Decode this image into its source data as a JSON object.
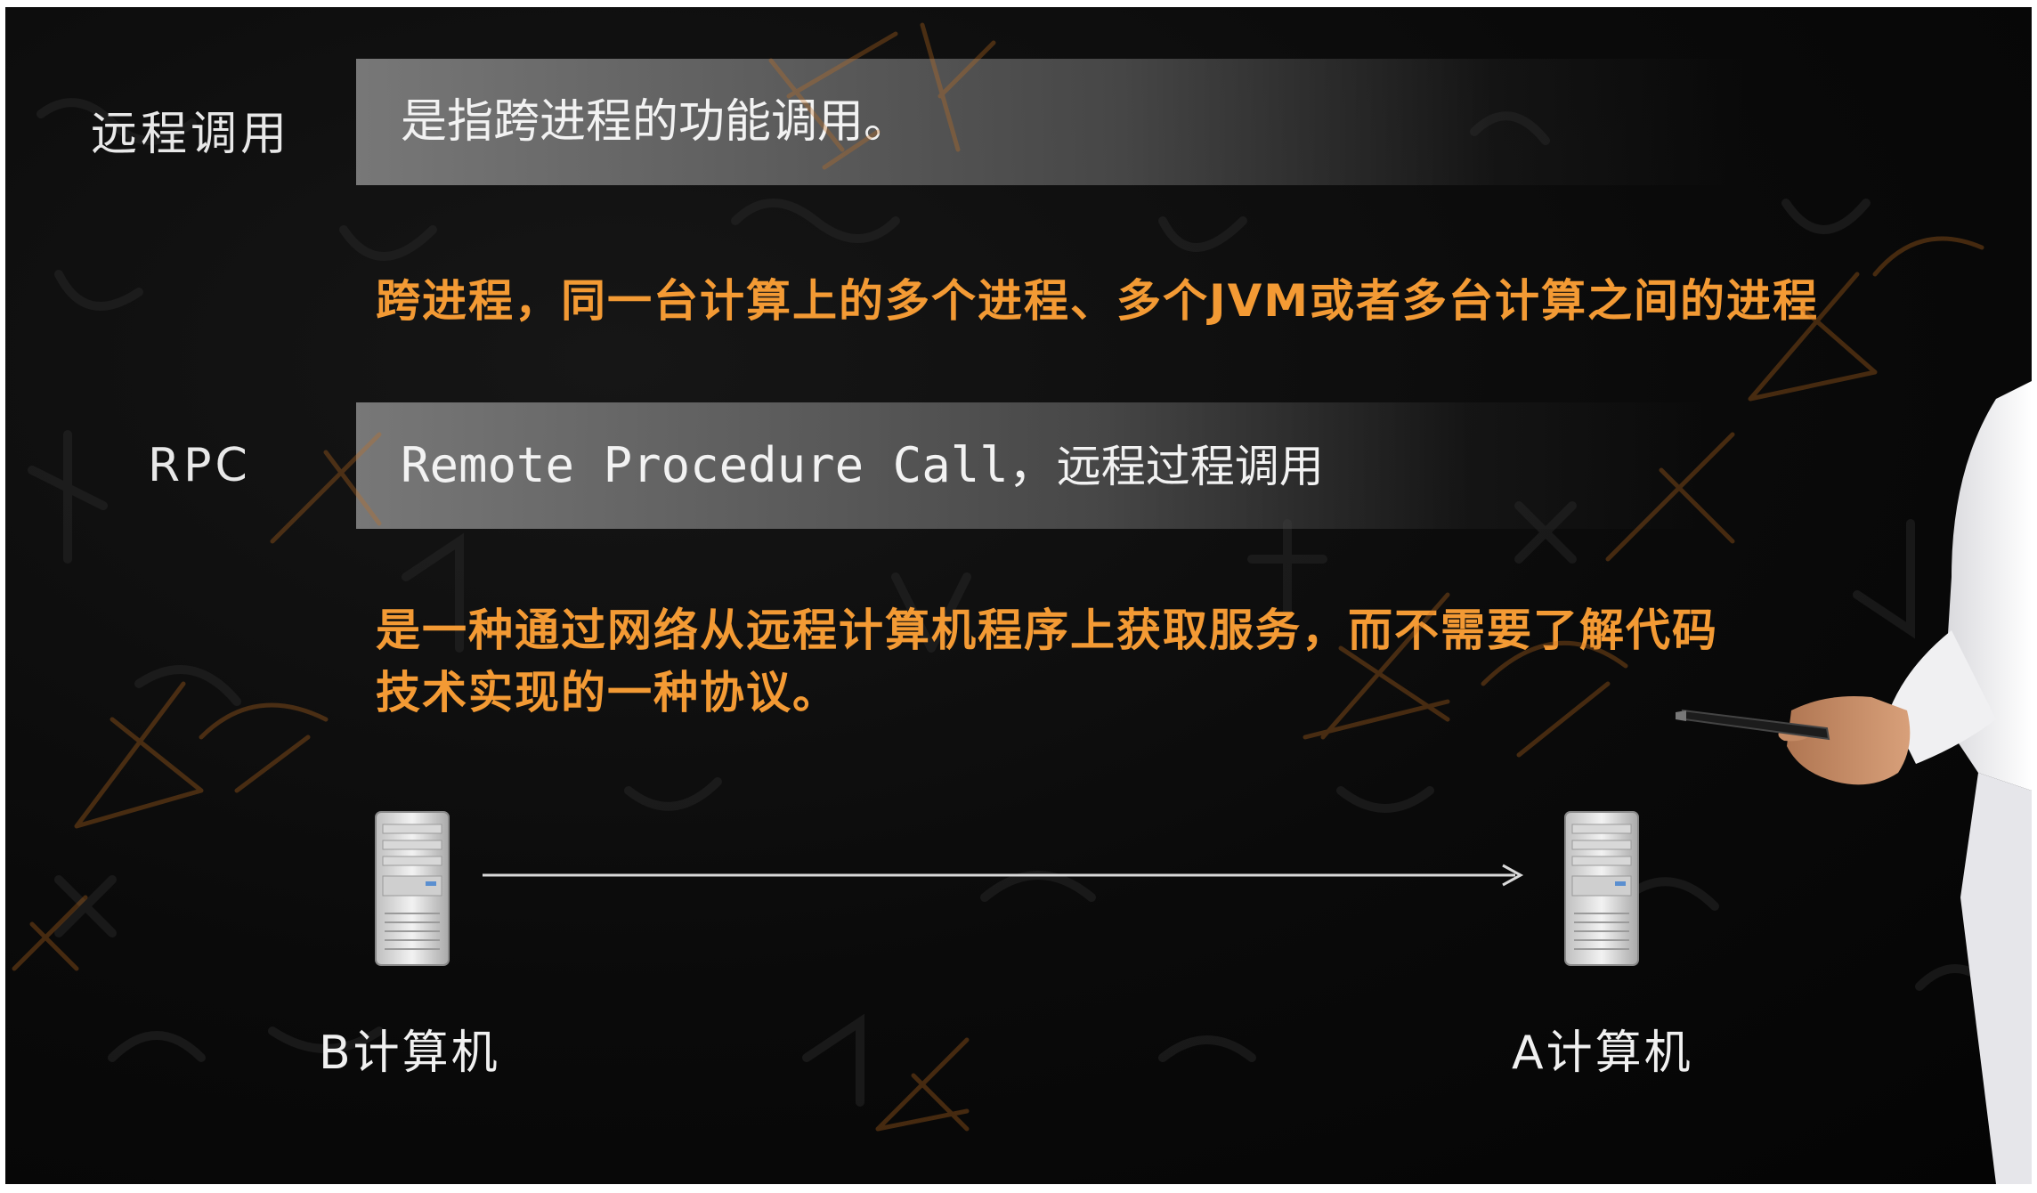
{
  "rows": [
    {
      "label": "远程调用",
      "text": "是指跨进程的功能调用。"
    },
    {
      "label": "RPC",
      "text_latin": "Remote Procedure Call，",
      "text_cn": "远程过程调用"
    }
  ],
  "notes": {
    "cross_process": "跨进程，同一台计算上的多个进程、多个JVM或者多台计算之间的进程",
    "rpc_line1": "是一种通过网络从远程计算机程序上获取服务，而不需要了解代码",
    "rpc_line2": "技术实现的一种协议。"
  },
  "computers": {
    "left": "B计算机",
    "right": "A计算机"
  },
  "colors": {
    "accent_text": "#f39a34",
    "background": "#0a0a0a",
    "bar": "#7d7d7d"
  },
  "icons": [
    "server-icon",
    "arrow-right-icon",
    "pointer-pen-icon"
  ]
}
